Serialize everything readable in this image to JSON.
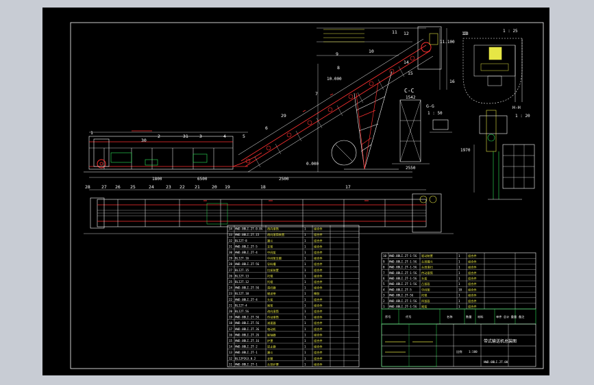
{
  "view": {
    "section_cc": "C-C",
    "section_gg": "G-G",
    "section_hh": "H-H",
    "detail_13": "13",
    "scale_detail": "1 : 25",
    "scale_gg": "1 : 50",
    "scale_hh": "1 : 20",
    "scale_cc": "1 : 20"
  },
  "elevations": [
    "11.100",
    "10.000",
    "0.000"
  ],
  "part_numbers_top": [
    "1",
    "2",
    "3",
    "4",
    "5",
    "6",
    "7",
    "8",
    "9",
    "10",
    "11",
    "12",
    "13",
    "14",
    "15",
    "16",
    "29",
    "30",
    "31"
  ],
  "part_numbers_bottom": [
    "28",
    "27",
    "26",
    "25",
    "24",
    "23",
    "22",
    "21",
    "20",
    "19",
    "18",
    "17"
  ],
  "dims": [
    "2550",
    "2500",
    "1800",
    "1542",
    "6500",
    "1970"
  ],
  "bom_left": [
    {
      "no": "34",
      "code": "HWD.0BLI.2T.0.0G",
      "name": "改向滚筒",
      "qty": "1",
      "mat": "组合件"
    },
    {
      "no": "33",
      "code": "HWD.0BLI.2T.15",
      "name": "改向滚筒装置",
      "qty": "1",
      "mat": "组合件"
    },
    {
      "no": "32",
      "code": "BLI2T-8",
      "name": "漏斗",
      "qty": "1",
      "mat": "组合件"
    },
    {
      "no": "31",
      "code": "HWD.0BLI.2T-5",
      "name": "支架",
      "qty": "1",
      "mat": "组合件"
    },
    {
      "no": "30",
      "code": "HWD.0BLI.2T-4",
      "name": "中间架",
      "qty": "1",
      "mat": "组合件"
    },
    {
      "no": "29",
      "code": "BLI2T.16",
      "name": "中间架支腿",
      "qty": "1",
      "mat": "组合件"
    },
    {
      "no": "28",
      "code": "HWD.0BLI.2T-5G",
      "name": "导料槽",
      "qty": "1",
      "mat": "组合件"
    },
    {
      "no": "27",
      "code": "BLI2T.15",
      "name": "拉紧装置",
      "qty": "1",
      "mat": "组合件"
    },
    {
      "no": "26",
      "code": "BLI2T.13",
      "name": "托辊",
      "qty": "1",
      "mat": "组合件"
    },
    {
      "no": "25",
      "code": "BLI2T.12",
      "name": "托辊",
      "qty": "1",
      "mat": "组合件"
    },
    {
      "no": "24",
      "code": "HWD.0BLI.2T-5G",
      "name": "清扫器",
      "qty": "1",
      "mat": "组合件"
    },
    {
      "no": "23",
      "code": "BLI2T.10",
      "name": "输送带",
      "qty": "1",
      "mat": "橡胶"
    },
    {
      "no": "22",
      "code": "HWD.0BLI.2T-4",
      "name": "头架",
      "qty": "1",
      "mat": "组合件"
    },
    {
      "no": "21",
      "code": "BLI2T-4",
      "name": "尾架",
      "qty": "1",
      "mat": "组合件"
    },
    {
      "no": "20",
      "code": "BLI2T.5G",
      "name": "改向滚筒",
      "qty": "1",
      "mat": "组合件"
    },
    {
      "no": "19",
      "code": "HWD.0BLI.2T.5G",
      "name": "传动滚筒",
      "qty": "1",
      "mat": "组合件"
    },
    {
      "no": "18",
      "code": "HWD.0BLI.2T.5G",
      "name": "减速器",
      "qty": "1",
      "mat": "组合件"
    },
    {
      "no": "17",
      "code": "HWD.0BLI.2T.3G",
      "name": "电动机",
      "qty": "1",
      "mat": "组合件"
    },
    {
      "no": "16",
      "code": "HWD.0BLI.2T.2G",
      "name": "联轴器",
      "qty": "1",
      "mat": "组合件"
    },
    {
      "no": "15",
      "code": "HWD.0BLI.2T.1G",
      "name": "护罩",
      "qty": "1",
      "mat": "组合件"
    },
    {
      "no": "14",
      "code": "HWD.0BLI.2T-2",
      "name": "逆止器",
      "qty": "1",
      "mat": "组合件"
    },
    {
      "no": "13",
      "code": "HWD.0BLI.2T-1",
      "name": "漏斗",
      "qty": "1",
      "mat": "组合件"
    },
    {
      "no": "12",
      "code": "BLI2P2G3.0.2",
      "name": "支腿",
      "qty": "1",
      "mat": "组合件"
    },
    {
      "no": "11",
      "code": "HWD.0BLI.2T-1",
      "name": "头部护罩",
      "qty": "1",
      "mat": "组合件"
    }
  ],
  "bom_right": [
    {
      "no": "10",
      "code": "HWD.0BLI.2T-1-5G",
      "name": "驱动装置",
      "qty": "1",
      "mat": "组合件"
    },
    {
      "no": "9",
      "code": "HWD.0BLI.2T-1-5G",
      "name": "头部漏斗",
      "qty": "1",
      "mat": "组合件"
    },
    {
      "no": "8",
      "code": "HWD.0BLI.2T-1-5G",
      "name": "头部清扫",
      "qty": "1",
      "mat": "组合件"
    },
    {
      "no": "7",
      "code": "HWD.0BLI.2T-1-5G",
      "name": "传动滚筒",
      "qty": "1",
      "mat": "组合件"
    },
    {
      "no": "6",
      "code": "HWD.0BLI.2T-1-5G",
      "name": "头架",
      "qty": "1",
      "mat": "组合件"
    },
    {
      "no": "5",
      "code": "HWD.0BLI.2T-1-5G",
      "name": "凸弧段",
      "qty": "1",
      "mat": "组合件"
    },
    {
      "no": "4",
      "code": "HWD.0BLI.2T-5",
      "name": "中间架",
      "qty": "10",
      "mat": "组合件"
    },
    {
      "no": "3",
      "code": "HWD.0BLI.2T-5G",
      "name": "托辊",
      "qty": "1",
      "mat": "组合件"
    },
    {
      "no": "2",
      "code": "HWD.0BLI.2T-1-5G",
      "name": "凹弧段",
      "qty": "1",
      "mat": "组合件"
    },
    {
      "no": "1",
      "code": "HWD.0BLI.2T-1-5G",
      "name": "尾架",
      "qty": "1",
      "mat": "组合件"
    }
  ],
  "bom_header": {
    "no": "序号",
    "code": "代号",
    "name": "名称",
    "qty": "数量",
    "mat": "材料",
    "mass": "单件 总计 重量",
    "remark": "备注"
  },
  "title_block": {
    "drawing_title": "带式输送机总装图",
    "scale_label": "比例",
    "scale_value": "1:100",
    "drawing_no": "HWD.0BLI.2T.00"
  }
}
